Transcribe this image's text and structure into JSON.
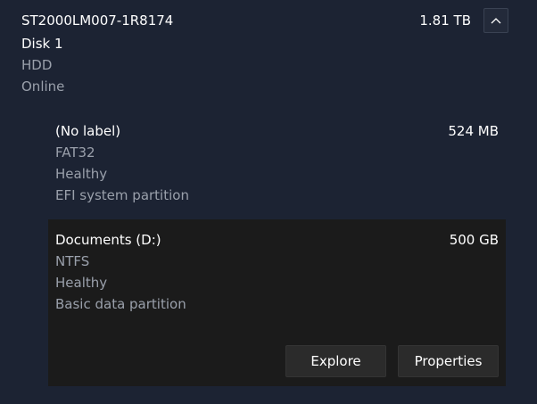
{
  "disk": {
    "model": "ST2000LM007-1R8174",
    "size": "1.81 TB",
    "name": "Disk 1",
    "type": "HDD",
    "status": "Online",
    "collapse_icon": "chevron-up-icon"
  },
  "partitions": [
    {
      "label": "(No label)",
      "size": "524 MB",
      "filesystem": "FAT32",
      "health": "Healthy",
      "kind": "EFI system partition"
    },
    {
      "label": "Documents (D:)",
      "size": "500 GB",
      "filesystem": "NTFS",
      "health": "Healthy",
      "kind": "Basic data partition",
      "selected": true,
      "actions": {
        "explore_label": "Explore",
        "properties_label": "Properties"
      }
    }
  ],
  "colors": {
    "background": "#1c2333",
    "selected_partition": "#1b1b1b",
    "secondary_text": "#9aa0ab",
    "button_bg": "#2b2b2b"
  }
}
